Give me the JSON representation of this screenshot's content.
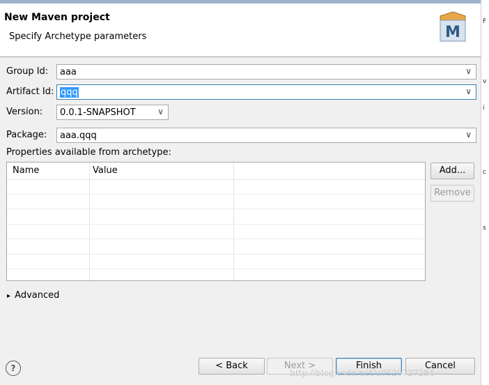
{
  "header": {
    "title": "New Maven project",
    "subtitle": "Specify Archetype parameters",
    "logo_text": "M"
  },
  "form": {
    "group_id_label": "Group Id:",
    "group_id_value": "aaa",
    "artifact_id_label": "Artifact Id:",
    "artifact_id_value": "qqq",
    "version_label": "Version:",
    "version_value": "0.0.1-SNAPSHOT",
    "package_label": "Package:",
    "package_value": "aaa.qqq",
    "dropdown_glyph": "∨"
  },
  "properties": {
    "label": "Properties available from archetype:",
    "columns": [
      "Name",
      "Value"
    ],
    "add_label": "Add...",
    "remove_label": "Remove"
  },
  "advanced": {
    "arrow": "▸",
    "label": "Advanced"
  },
  "footer": {
    "help_label": "?",
    "back_label": "< Back",
    "next_label": "Next >",
    "finish_label": "Finish",
    "cancel_label": "Cancel"
  },
  "watermark": "http://blog.csdn.net/u0520727284",
  "background_edge_fragments": [
    "F",
    "v",
    "i",
    "c",
    "s"
  ],
  "colors": {
    "selection": "#3399ff",
    "focus_border": "#3c7fb1"
  }
}
